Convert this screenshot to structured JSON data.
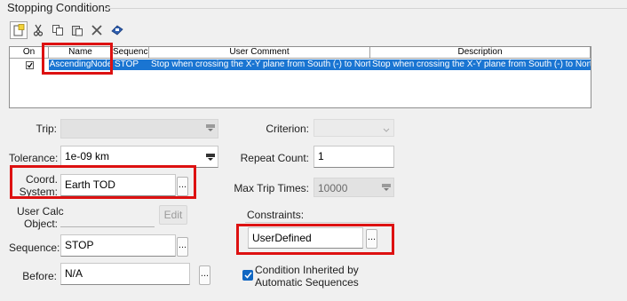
{
  "panel": {
    "title": "Stopping Conditions"
  },
  "toolbar": {
    "buttons": [
      {
        "name": "new-icon"
      },
      {
        "name": "cut-icon"
      },
      {
        "name": "copy-icon"
      },
      {
        "name": "paste-icon"
      },
      {
        "name": "delete-icon"
      },
      {
        "name": "properties-icon"
      }
    ]
  },
  "table": {
    "columns": [
      "On",
      "Name",
      "Sequence",
      "User Comment",
      "Description"
    ],
    "rows": [
      {
        "on": true,
        "name": "AscendingNode",
        "sequence": "STOP",
        "user_comment": "Stop when crossing the X-Y plane from South (-) to North (+)",
        "description": "Stop when crossing the X-Y plane from South (-) to North (+)"
      }
    ]
  },
  "form": {
    "trip": {
      "label": "Trip:",
      "value": ""
    },
    "tolerance": {
      "label": "Tolerance:",
      "value": "1e-09 km"
    },
    "coord_system": {
      "label_line1": "Coord.",
      "label_line2": "System:",
      "value": "Earth TOD",
      "button": "..."
    },
    "user_calc": {
      "label_line1": "User Calc",
      "label_line2": "Object:",
      "value": "",
      "button": "Edit"
    },
    "sequence": {
      "label": "Sequence:",
      "value": "STOP",
      "button": "..."
    },
    "before": {
      "label": "Before:",
      "value": "N/A",
      "button": "..."
    },
    "criterion": {
      "label": "Criterion:",
      "value": ""
    },
    "repeat_count": {
      "label": "Repeat Count:",
      "value": "1"
    },
    "max_trip_times": {
      "label": "Max Trip Times:",
      "value": "10000"
    },
    "constraints": {
      "label": "Constraints:",
      "value": "UserDefined",
      "button": "..."
    },
    "inherited": {
      "checked": true,
      "label_line1": "Condition Inherited by",
      "label_line2": "Automatic Sequences"
    }
  },
  "colors": {
    "selection": "#1a75d2",
    "highlight": "#dd1111",
    "checkbox": "#0f66c2"
  }
}
